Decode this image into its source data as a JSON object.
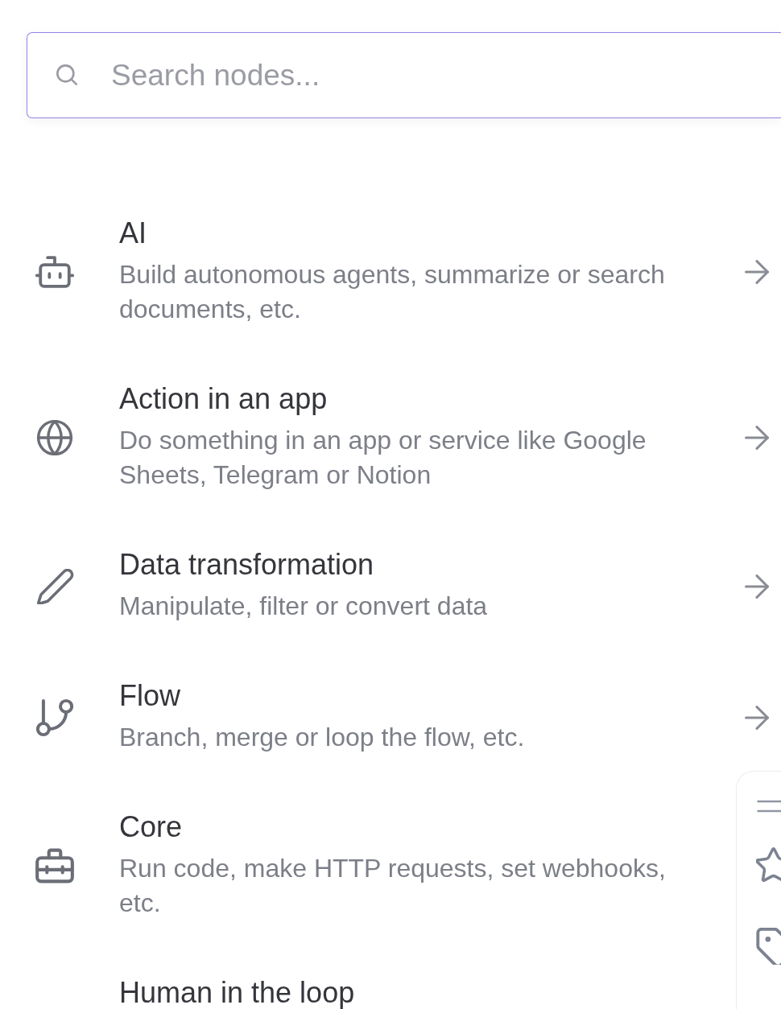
{
  "search": {
    "placeholder": "Search nodes..."
  },
  "categories": [
    {
      "title": "AI",
      "description": "Build autonomous agents, summarize or search documents, etc."
    },
    {
      "title": "Action in an app",
      "description": "Do something in an app or service like Google Sheets, Telegram or Notion"
    },
    {
      "title": "Data transformation",
      "description": "Manipulate, filter or convert data"
    },
    {
      "title": "Flow",
      "description": "Branch, merge or loop the flow, etc."
    },
    {
      "title": "Core",
      "description": "Run code, make HTTP requests, set webhooks, etc."
    },
    {
      "title": "Human in the loop"
    }
  ]
}
